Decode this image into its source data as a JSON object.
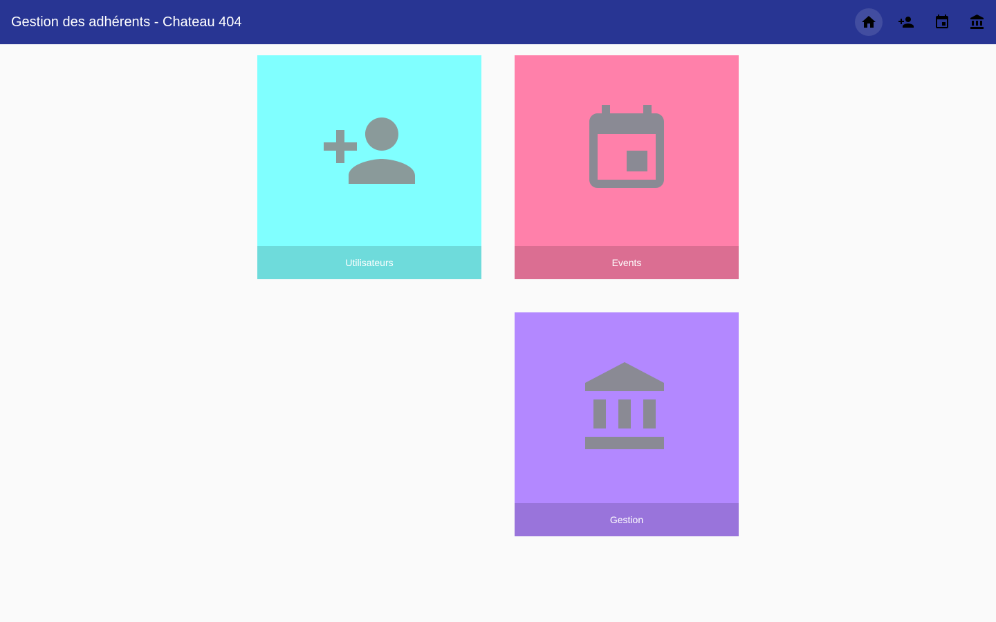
{
  "toolbar": {
    "title": "Gestion des adhérents - Chateau 404",
    "background": "#283593",
    "nav": [
      {
        "name": "home",
        "icon": "home-icon",
        "active": true
      },
      {
        "name": "users",
        "icon": "person-add-icon",
        "active": false
      },
      {
        "name": "events",
        "icon": "event-icon",
        "active": false
      },
      {
        "name": "gestion",
        "icon": "account-balance-icon",
        "active": false
      }
    ]
  },
  "tiles": [
    {
      "label": "Utilisateurs",
      "icon": "person-add-icon",
      "color": "#80ffff"
    },
    {
      "label": "Events",
      "icon": "event-icon",
      "color": "#ff80aa"
    },
    {
      "label": "Gestion",
      "icon": "account-balance-icon",
      "color": "#b388ff"
    }
  ],
  "colors": {
    "page_background": "#fafafa",
    "icon_gray": "#8a9a9a"
  }
}
